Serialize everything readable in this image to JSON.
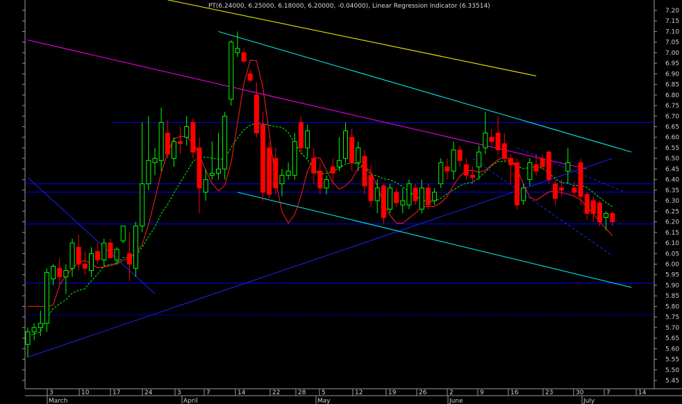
{
  "chart_data": {
    "type": "candlestick",
    "title": "PT(6.24000, 6.25000, 6.18000, 6.20000, -0.04000), Linear Regression Indicator (6.33514)",
    "y_axis": {
      "min": 5.45,
      "max": 7.2,
      "step": 0.05,
      "side": "right",
      "decimals": 2
    },
    "x_ticks": [
      "3",
      "10",
      "17",
      "24",
      "3",
      "7",
      "14",
      "22",
      "28",
      "5",
      "12",
      "19",
      "26",
      "2",
      "9",
      "16",
      "23",
      "30",
      "7",
      "14"
    ],
    "months": [
      "March",
      "April",
      "May",
      "June",
      "July"
    ],
    "colors": {
      "up": "#00ff00",
      "down": "#ff0000",
      "linreg": "#ff2020",
      "ma": "#00ff00",
      "hline": "#0000ff",
      "trend": "#2020ff",
      "channel": "#00ffff",
      "upper_trend": "#ff00ff",
      "top_trend": "#ffff00"
    },
    "horizontal_lines": [
      6.67,
      6.38,
      6.34,
      6.19,
      5.91,
      5.76
    ],
    "candles": [
      {
        "o": 5.62,
        "h": 5.7,
        "l": 5.56,
        "c": 5.68
      },
      {
        "o": 5.68,
        "h": 5.72,
        "l": 5.64,
        "c": 5.7
      },
      {
        "o": 5.7,
        "h": 5.78,
        "l": 5.66,
        "c": 5.72
      },
      {
        "o": 5.72,
        "h": 5.98,
        "l": 5.68,
        "c": 5.96
      },
      {
        "o": 5.93,
        "h": 6.0,
        "l": 5.9,
        "c": 5.99
      },
      {
        "o": 5.98,
        "h": 6.03,
        "l": 5.9,
        "c": 5.94
      },
      {
        "o": 5.94,
        "h": 6.0,
        "l": 5.86,
        "c": 5.97
      },
      {
        "o": 5.98,
        "h": 6.12,
        "l": 5.94,
        "c": 6.1
      },
      {
        "o": 6.08,
        "h": 6.14,
        "l": 5.97,
        "c": 6.0
      },
      {
        "o": 6.0,
        "h": 6.06,
        "l": 5.95,
        "c": 5.98
      },
      {
        "o": 5.97,
        "h": 6.08,
        "l": 5.94,
        "c": 6.05
      },
      {
        "o": 6.06,
        "h": 6.1,
        "l": 6.0,
        "c": 6.02
      },
      {
        "o": 6.02,
        "h": 6.12,
        "l": 5.99,
        "c": 6.1
      },
      {
        "o": 6.1,
        "h": 6.12,
        "l": 6.05,
        "c": 6.03
      },
      {
        "o": 6.02,
        "h": 6.08,
        "l": 6.0,
        "c": 6.07
      },
      {
        "o": 6.11,
        "h": 6.18,
        "l": 6.1,
        "c": 6.18
      },
      {
        "o": 6.05,
        "h": 6.15,
        "l": 5.92,
        "c": 6.0
      },
      {
        "o": 5.98,
        "h": 6.2,
        "l": 5.94,
        "c": 6.18
      },
      {
        "o": 6.18,
        "h": 6.67,
        "l": 6.15,
        "c": 6.38
      },
      {
        "o": 6.38,
        "h": 6.7,
        "l": 6.35,
        "c": 6.49
      },
      {
        "o": 6.48,
        "h": 6.55,
        "l": 6.42,
        "c": 6.5
      },
      {
        "o": 6.49,
        "h": 6.74,
        "l": 6.44,
        "c": 6.67
      },
      {
        "o": 6.62,
        "h": 6.68,
        "l": 6.5,
        "c": 6.52
      },
      {
        "o": 6.5,
        "h": 6.6,
        "l": 6.46,
        "c": 6.58
      },
      {
        "o": 6.58,
        "h": 6.65,
        "l": 6.52,
        "c": 6.57
      },
      {
        "o": 6.6,
        "h": 6.7,
        "l": 6.56,
        "c": 6.65
      },
      {
        "o": 6.67,
        "h": 6.69,
        "l": 6.5,
        "c": 6.53
      },
      {
        "o": 6.55,
        "h": 6.6,
        "l": 6.24,
        "c": 6.36
      },
      {
        "o": 6.34,
        "h": 6.45,
        "l": 6.3,
        "c": 6.4
      },
      {
        "o": 6.42,
        "h": 6.58,
        "l": 6.4,
        "c": 6.43
      },
      {
        "o": 6.43,
        "h": 6.62,
        "l": 6.4,
        "c": 6.45
      },
      {
        "o": 6.45,
        "h": 6.72,
        "l": 6.4,
        "c": 6.7
      },
      {
        "o": 6.78,
        "h": 7.06,
        "l": 6.75,
        "c": 7.05
      },
      {
        "o": 7.0,
        "h": 7.1,
        "l": 6.98,
        "c": 7.02
      },
      {
        "o": 7.0,
        "h": 7.02,
        "l": 6.95,
        "c": 6.96
      },
      {
        "o": 6.9,
        "h": 6.92,
        "l": 6.86,
        "c": 6.87
      },
      {
        "o": 6.8,
        "h": 6.86,
        "l": 6.6,
        "c": 6.62
      },
      {
        "o": 6.66,
        "h": 6.72,
        "l": 6.3,
        "c": 6.34
      },
      {
        "o": 6.55,
        "h": 6.58,
        "l": 6.31,
        "c": 6.33
      },
      {
        "o": 6.5,
        "h": 6.55,
        "l": 6.33,
        "c": 6.36
      },
      {
        "o": 6.38,
        "h": 6.45,
        "l": 6.32,
        "c": 6.42
      },
      {
        "o": 6.42,
        "h": 6.48,
        "l": 6.4,
        "c": 6.44
      },
      {
        "o": 6.42,
        "h": 6.62,
        "l": 6.4,
        "c": 6.58
      },
      {
        "o": 6.67,
        "h": 6.7,
        "l": 6.52,
        "c": 6.55
      },
      {
        "o": 6.55,
        "h": 6.66,
        "l": 6.5,
        "c": 6.63
      },
      {
        "o": 6.5,
        "h": 6.55,
        "l": 6.38,
        "c": 6.43
      },
      {
        "o": 6.44,
        "h": 6.48,
        "l": 6.33,
        "c": 6.36
      },
      {
        "o": 6.36,
        "h": 6.42,
        "l": 6.33,
        "c": 6.4
      },
      {
        "o": 6.46,
        "h": 6.5,
        "l": 6.38,
        "c": 6.43
      },
      {
        "o": 6.46,
        "h": 6.6,
        "l": 6.44,
        "c": 6.49
      },
      {
        "o": 6.5,
        "h": 6.67,
        "l": 6.48,
        "c": 6.63
      },
      {
        "o": 6.6,
        "h": 6.64,
        "l": 6.44,
        "c": 6.48
      },
      {
        "o": 6.48,
        "h": 6.58,
        "l": 6.44,
        "c": 6.55
      },
      {
        "o": 6.51,
        "h": 6.54,
        "l": 6.33,
        "c": 6.37
      },
      {
        "o": 6.42,
        "h": 6.47,
        "l": 6.27,
        "c": 6.3
      },
      {
        "o": 6.3,
        "h": 6.4,
        "l": 6.24,
        "c": 6.36
      },
      {
        "o": 6.37,
        "h": 6.38,
        "l": 6.19,
        "c": 6.22
      },
      {
        "o": 6.26,
        "h": 6.38,
        "l": 6.24,
        "c": 6.36
      },
      {
        "o": 6.34,
        "h": 6.36,
        "l": 6.27,
        "c": 6.29
      },
      {
        "o": 6.28,
        "h": 6.36,
        "l": 6.24,
        "c": 6.3
      },
      {
        "o": 6.28,
        "h": 6.4,
        "l": 6.26,
        "c": 6.38
      },
      {
        "o": 6.36,
        "h": 6.38,
        "l": 6.28,
        "c": 6.3
      },
      {
        "o": 6.26,
        "h": 6.4,
        "l": 6.24,
        "c": 6.36
      },
      {
        "o": 6.36,
        "h": 6.38,
        "l": 6.26,
        "c": 6.28
      },
      {
        "o": 6.3,
        "h": 6.36,
        "l": 6.28,
        "c": 6.34
      },
      {
        "o": 6.38,
        "h": 6.5,
        "l": 6.36,
        "c": 6.48
      },
      {
        "o": 6.46,
        "h": 6.5,
        "l": 6.4,
        "c": 6.44
      },
      {
        "o": 6.44,
        "h": 6.58,
        "l": 6.4,
        "c": 6.54
      },
      {
        "o": 6.54,
        "h": 6.56,
        "l": 6.46,
        "c": 6.49
      },
      {
        "o": 6.47,
        "h": 6.5,
        "l": 6.4,
        "c": 6.42
      },
      {
        "o": 6.42,
        "h": 6.46,
        "l": 6.38,
        "c": 6.41
      },
      {
        "o": 6.46,
        "h": 6.56,
        "l": 6.4,
        "c": 6.53
      },
      {
        "o": 6.55,
        "h": 6.72,
        "l": 6.52,
        "c": 6.62
      },
      {
        "o": 6.6,
        "h": 6.64,
        "l": 6.56,
        "c": 6.58
      },
      {
        "o": 6.62,
        "h": 6.7,
        "l": 6.52,
        "c": 6.54
      },
      {
        "o": 6.57,
        "h": 6.62,
        "l": 6.48,
        "c": 6.5
      },
      {
        "o": 6.5,
        "h": 6.52,
        "l": 6.38,
        "c": 6.47
      },
      {
        "o": 6.48,
        "h": 6.5,
        "l": 6.26,
        "c": 6.28
      },
      {
        "o": 6.3,
        "h": 6.38,
        "l": 6.28,
        "c": 6.36
      },
      {
        "o": 6.4,
        "h": 6.5,
        "l": 6.37,
        "c": 6.48
      },
      {
        "o": 6.47,
        "h": 6.52,
        "l": 6.42,
        "c": 6.44
      },
      {
        "o": 6.5,
        "h": 6.52,
        "l": 6.45,
        "c": 6.46
      },
      {
        "o": 6.53,
        "h": 6.54,
        "l": 6.38,
        "c": 6.4
      },
      {
        "o": 6.38,
        "h": 6.4,
        "l": 6.28,
        "c": 6.31
      },
      {
        "o": 6.36,
        "h": 6.4,
        "l": 6.32,
        "c": 6.35
      },
      {
        "o": 6.44,
        "h": 6.55,
        "l": 6.38,
        "c": 6.48
      },
      {
        "o": 6.36,
        "h": 6.39,
        "l": 6.32,
        "c": 6.34
      },
      {
        "o": 6.48,
        "h": 6.5,
        "l": 6.28,
        "c": 6.32
      },
      {
        "o": 6.33,
        "h": 6.34,
        "l": 6.21,
        "c": 6.24
      },
      {
        "o": 6.3,
        "h": 6.32,
        "l": 6.2,
        "c": 6.24
      },
      {
        "o": 6.29,
        "h": 6.3,
        "l": 6.18,
        "c": 6.2
      },
      {
        "o": 6.22,
        "h": 6.25,
        "l": 6.16,
        "c": 6.24
      },
      {
        "o": 6.24,
        "h": 6.25,
        "l": 6.18,
        "c": 6.2
      }
    ]
  }
}
